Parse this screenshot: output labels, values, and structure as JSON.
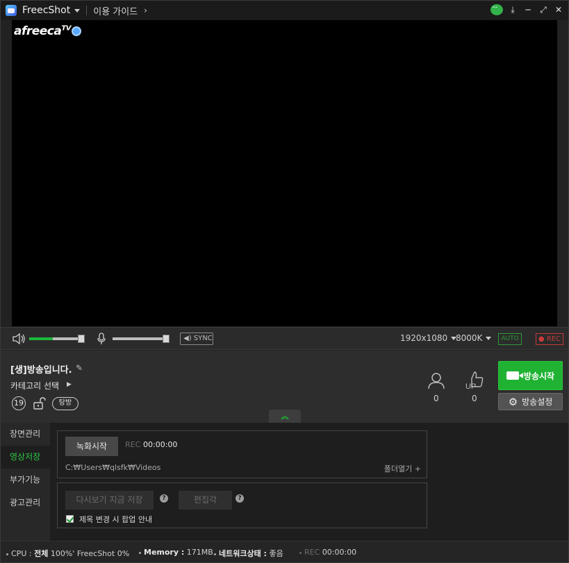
{
  "titlebar": {
    "app_name": "FreecShot",
    "guide_label": "이용 가이드",
    "guide_arrow": "›"
  },
  "video": {
    "logo_text": "afreeca",
    "logo_tv": "TV"
  },
  "controls": {
    "volume_fraction": 0.42,
    "mic_fraction": 1.0,
    "sync_label": "SYNC",
    "resolution": "1920x1080",
    "bitrate": "8000K",
    "auto_label": "AUTO",
    "rec_label": "● REC"
  },
  "info": {
    "broadcast_title": "[생]방송입니다.",
    "category_label": "카테고리 선택",
    "age_label": "19",
    "tangbang_label": "탕방",
    "viewer_count": "0",
    "up_count": "0",
    "start_button": "방송시작",
    "settings_button": "방송설정"
  },
  "sidebar": {
    "items": [
      {
        "label": "장면관리"
      },
      {
        "label": "영상저장"
      },
      {
        "label": "부가기능"
      },
      {
        "label": "광고관리"
      }
    ]
  },
  "recording": {
    "record_button": "녹화시작",
    "rec_label": "REC",
    "rec_time": "00:00:00",
    "save_path": "C:₩Users₩qlsfk₩Videos",
    "open_folder": "폴더열기 +",
    "replay_button": "다시보기 지금 저장",
    "edit_button": "편집각",
    "popup_checkbox_label": "제목 변경 시 팝업 안내",
    "popup_checked": true
  },
  "statusbar": {
    "cpu_label": "CPU :",
    "cpu_total_label": "전체",
    "cpu_total": "100%'",
    "freecshot_label": "FreecShot",
    "freecshot_cpu": "0%",
    "memory_label": "Memory :",
    "memory_value": "171MB",
    "network_label": "네트워크상태 :",
    "network_value": "좋음",
    "rec_label": "REC",
    "rec_time": "00:00:00"
  }
}
